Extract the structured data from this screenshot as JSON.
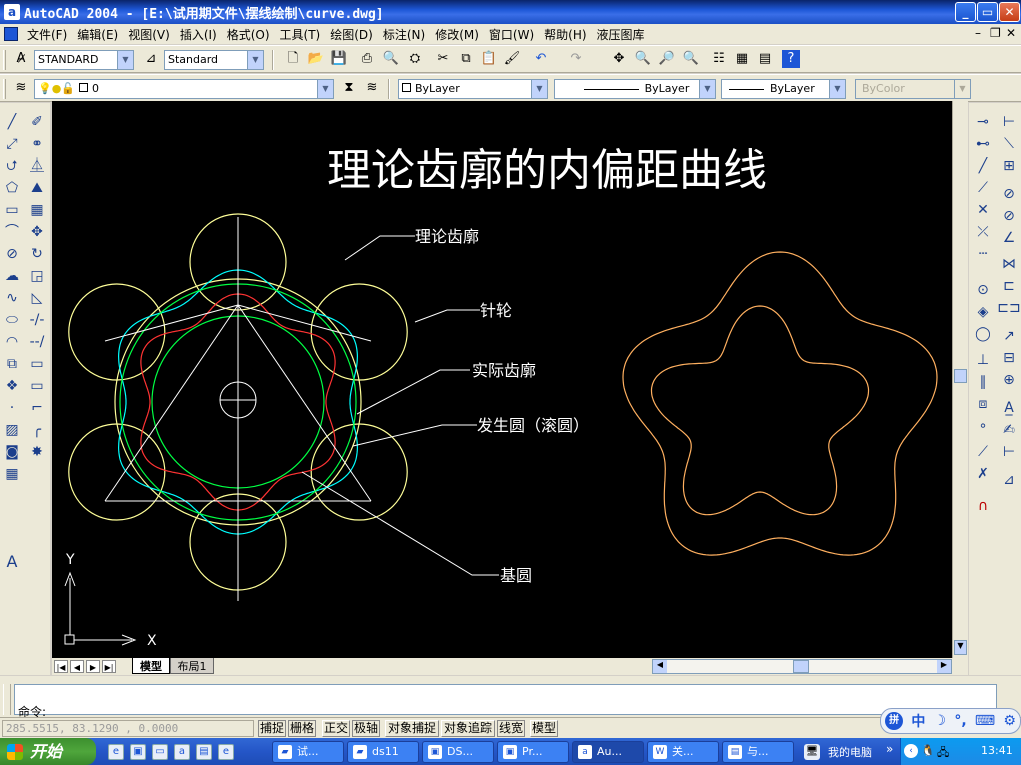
{
  "window": {
    "title": "AutoCAD 2004 - [E:\\试用期文件\\摆线绘制\\curve.dwg]",
    "app_icon": "a",
    "btn_min": "_",
    "btn_max": "▭",
    "btn_close": "✕"
  },
  "menu": {
    "items": [
      "文件(F)",
      "编辑(E)",
      "视图(V)",
      "插入(I)",
      "格式(O)",
      "工具(T)",
      "绘图(D)",
      "标注(N)",
      "修改(M)",
      "窗口(W)",
      "帮助(H)",
      "液压图库"
    ],
    "doc_controls": [
      "–",
      "❐",
      "✕"
    ]
  },
  "toolbar1": {
    "text_style": "STANDARD",
    "dim_style": "Standard"
  },
  "toolbar2": {
    "layer_value": "0",
    "color_value": "ByLayer",
    "linetype_value": "ByLayer",
    "lineweight_value": "ByLayer",
    "plotstyle_value": "ByColor"
  },
  "drawing": {
    "title": "理论齿廓的内偏距曲线",
    "labels": {
      "theoretical_profile": "理论齿廓",
      "pin_wheel": "针轮",
      "actual_profile": "实际齿廓",
      "generating_circle": "发生圆（滚圆）",
      "base_circle": "基圆"
    },
    "ucs_y": "Y",
    "ucs_x": "X",
    "colors": {
      "background": "#000000",
      "title_text": "#ffffff",
      "pin_circles": "#ffff99",
      "theoretical": "#00ffff",
      "actual": "#ff3333",
      "generating": "#00ff44",
      "offset_curve": "#ffb060"
    }
  },
  "layout_tabs": {
    "model": "模型",
    "layout1": "布局1"
  },
  "command": {
    "prompt": "命令:"
  },
  "status": {
    "coords": "285.5515,  83.1290 ,  0.0000",
    "toggles": [
      "捕捉",
      "栅格",
      "正交",
      "极轴",
      "对象捕捉",
      "对象追踪",
      "线宽",
      "模型"
    ]
  },
  "taskbar": {
    "start": "开始",
    "tasks": [
      "试...",
      "ds11",
      "DS...",
      "Pr...",
      "Au...",
      "关...",
      "与..."
    ],
    "my_computer": "我的电脑",
    "clock": "13:41"
  },
  "ime": {
    "label": "中"
  }
}
